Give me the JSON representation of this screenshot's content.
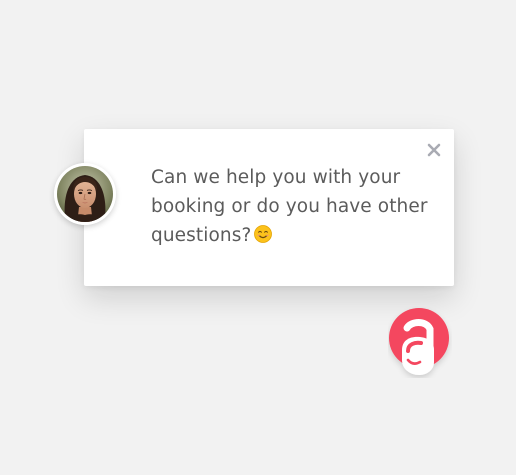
{
  "popup": {
    "message": "Can we help you with your booking or do you have other questions?",
    "emoji_icon": "smiling-face-icon",
    "close_icon": "close-icon"
  },
  "agent": {
    "avatar_icon": "agent-photo"
  },
  "launcher": {
    "logo_icon": "chat-logo-icon",
    "brand_color": "#f4465e"
  },
  "colors": {
    "background": "#f2f2f2",
    "text": "#5b5b5b",
    "close": "#a9abb3"
  }
}
